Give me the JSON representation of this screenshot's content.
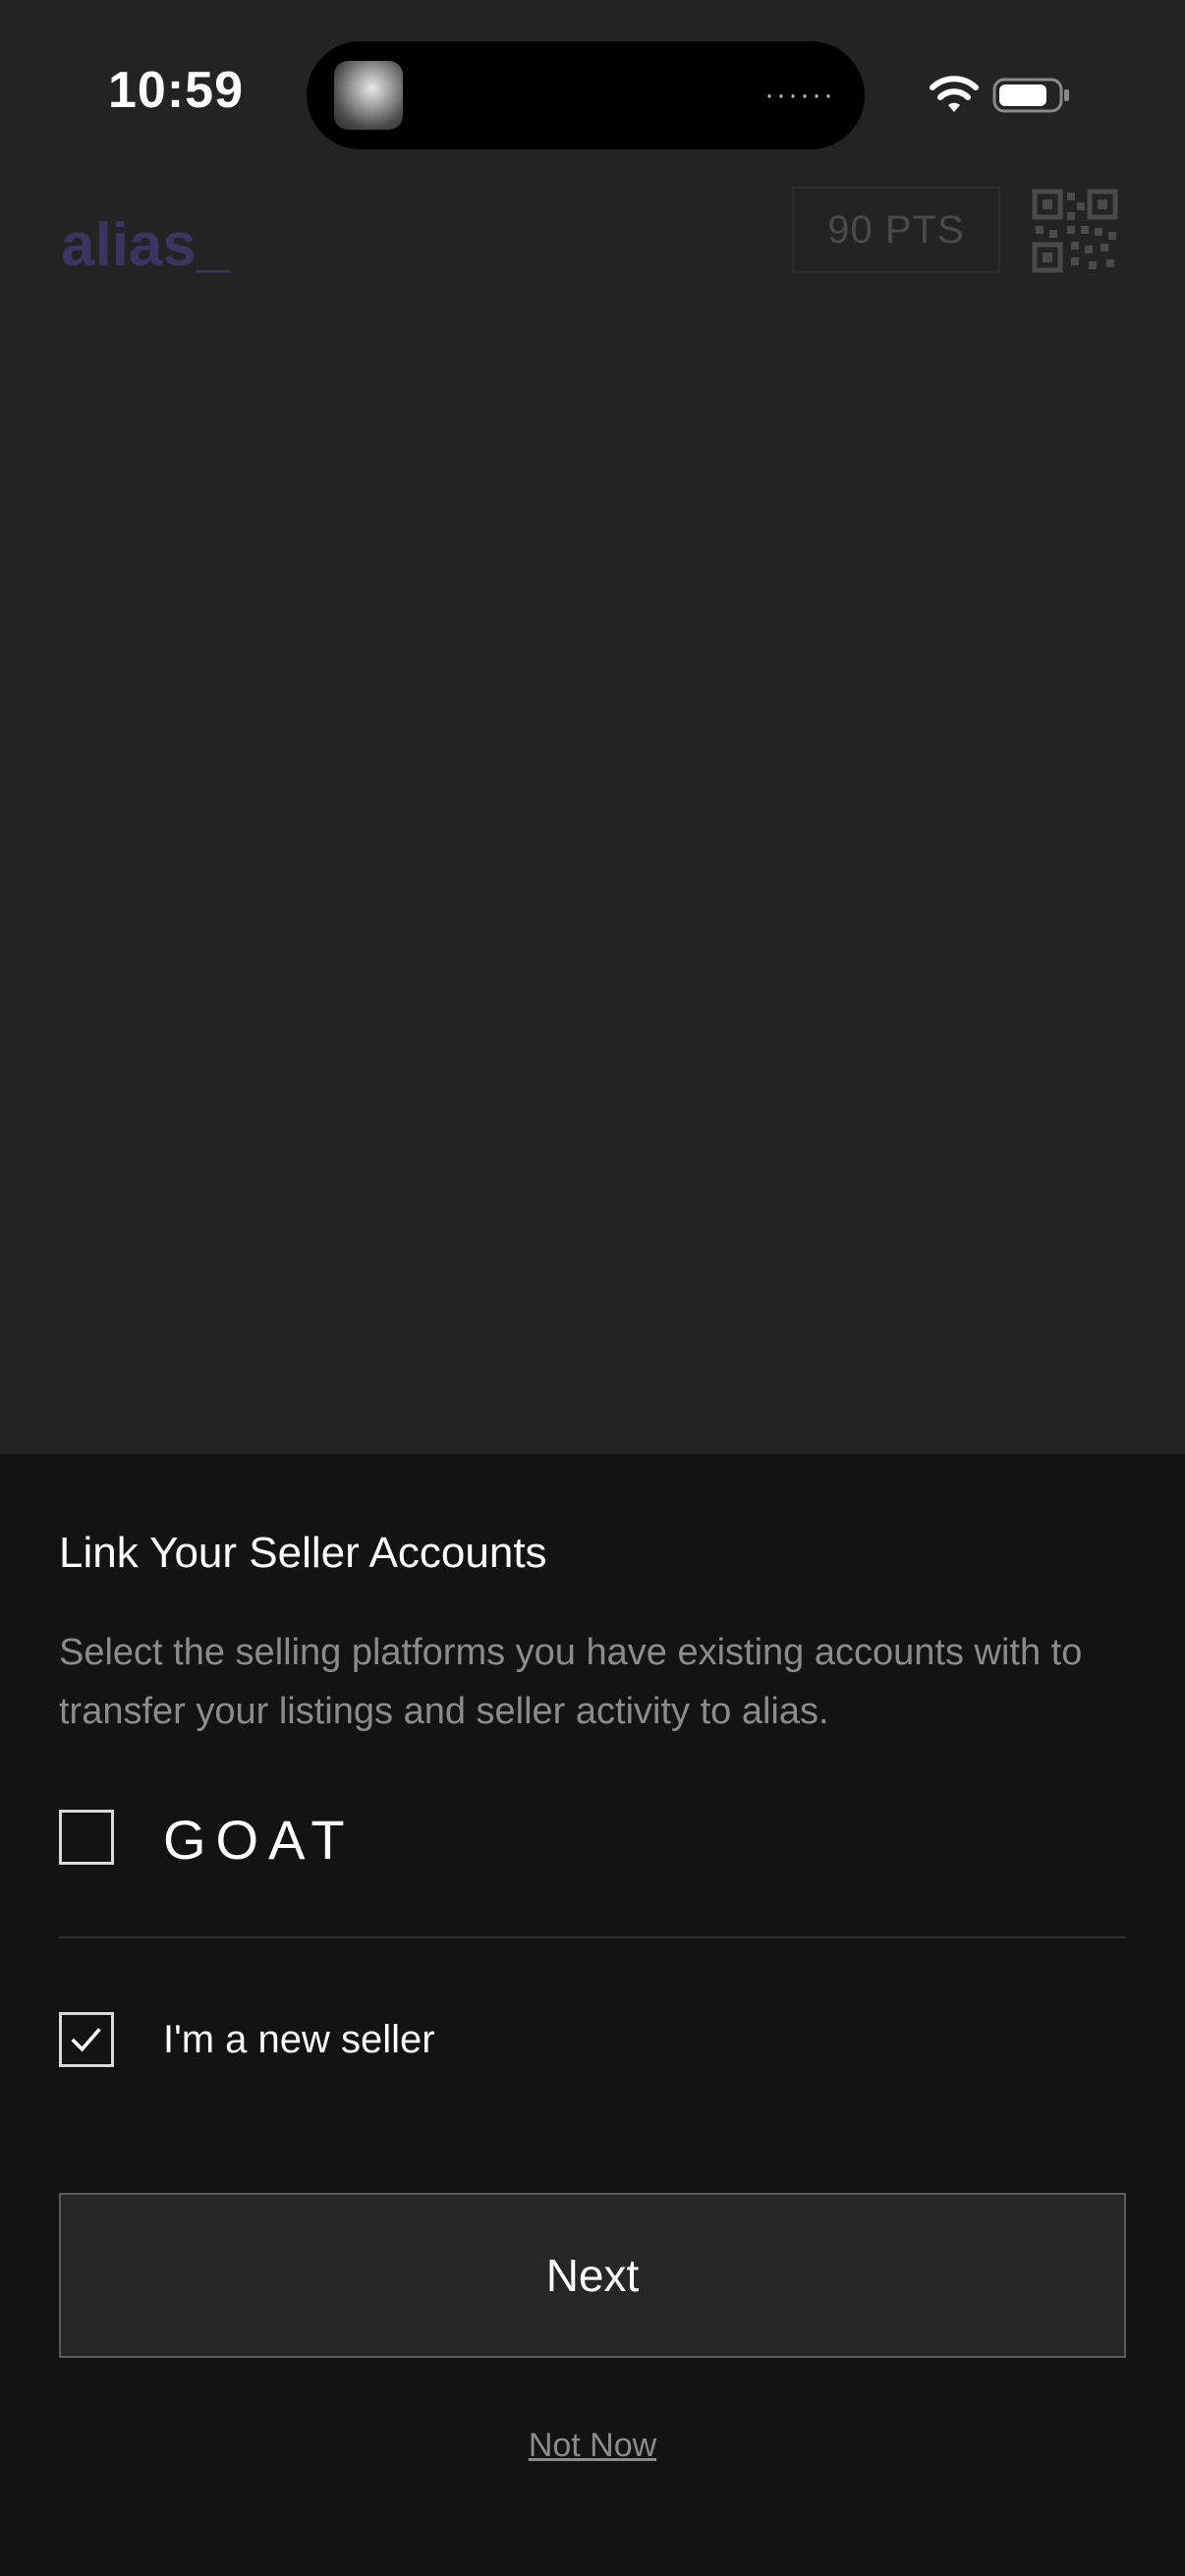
{
  "status_bar": {
    "time": "10:59",
    "island_dots": "······"
  },
  "header": {
    "logo_text": "alias_",
    "points_badge": "90 PTS",
    "brand_color": "#3a3560"
  },
  "sheet": {
    "title": "Link Your Seller Accounts",
    "description": "Select the selling platforms you have existing accounts with to transfer your listings and seller activity to alias.",
    "options": [
      {
        "label": "GOAT",
        "checked": false
      },
      {
        "label": "I'm a new seller",
        "checked": true
      }
    ],
    "next_label": "Next",
    "not_now_label": "Not Now"
  }
}
